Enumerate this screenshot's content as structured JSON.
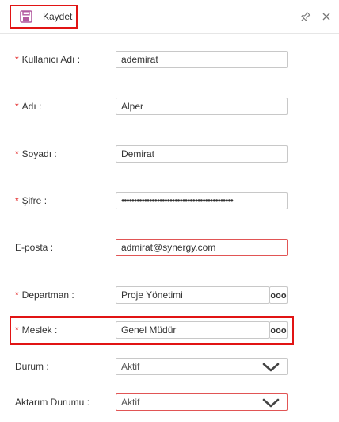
{
  "toolbar": {
    "save_label": "Kaydet",
    "save_icon": "floppy-disk-icon",
    "pin_icon": "pin-icon",
    "close_icon": "close-icon",
    "save_icon_color": "#b25aa0"
  },
  "form": {
    "required_marker": "*",
    "username": {
      "label": "Kullanıcı Adı",
      "value": "ademirat"
    },
    "first_name": {
      "label": "Adı",
      "value": "Alper"
    },
    "last_name": {
      "label": "Soyadı",
      "value": "Demirat"
    },
    "password": {
      "label": "Şifre",
      "value": "••••••••••••••••••••••••••••••••••••••••••••"
    },
    "email": {
      "label": "E-posta",
      "value": "admirat@synergy.com"
    },
    "department": {
      "label": "Departman",
      "value": "Proje Yönetimi",
      "lookup_label": "ooo"
    },
    "profession": {
      "label": "Meslek",
      "value": "Genel Müdür",
      "lookup_label": "ooo"
    },
    "status": {
      "label": "Durum",
      "value": "Aktif"
    },
    "transfer_status": {
      "label": "Aktarım Durumu",
      "value": "Aktif"
    }
  },
  "colors": {
    "required": "#e11414",
    "error_border": "#e15555",
    "highlight": "#e11414"
  }
}
